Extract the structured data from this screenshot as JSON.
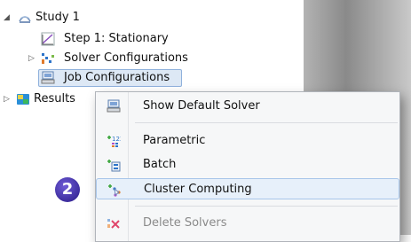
{
  "tree": {
    "items": [
      {
        "label": "Study 1",
        "icon": "study-icon",
        "expanded": true
      },
      {
        "label": "Step 1: Stationary",
        "icon": "stationary-step-icon"
      },
      {
        "label": "Solver Configurations",
        "icon": "solver-configurations-icon",
        "expanded": false
      },
      {
        "label": "Job Configurations",
        "icon": "job-configurations-icon",
        "selected": true
      },
      {
        "label": "Results",
        "icon": "results-icon",
        "expanded": false
      }
    ]
  },
  "context_menu": {
    "items": [
      {
        "label": "Show Default Solver",
        "icon": "show-default-solver-icon"
      },
      {
        "label": "Parametric",
        "icon": "parametric-icon"
      },
      {
        "label": "Batch",
        "icon": "batch-icon"
      },
      {
        "label": "Cluster Computing",
        "icon": "cluster-computing-icon",
        "highlighted": true
      },
      {
        "label": "Delete Solvers",
        "icon": "delete-solvers-icon",
        "disabled": true
      }
    ]
  },
  "step_badge": "2"
}
